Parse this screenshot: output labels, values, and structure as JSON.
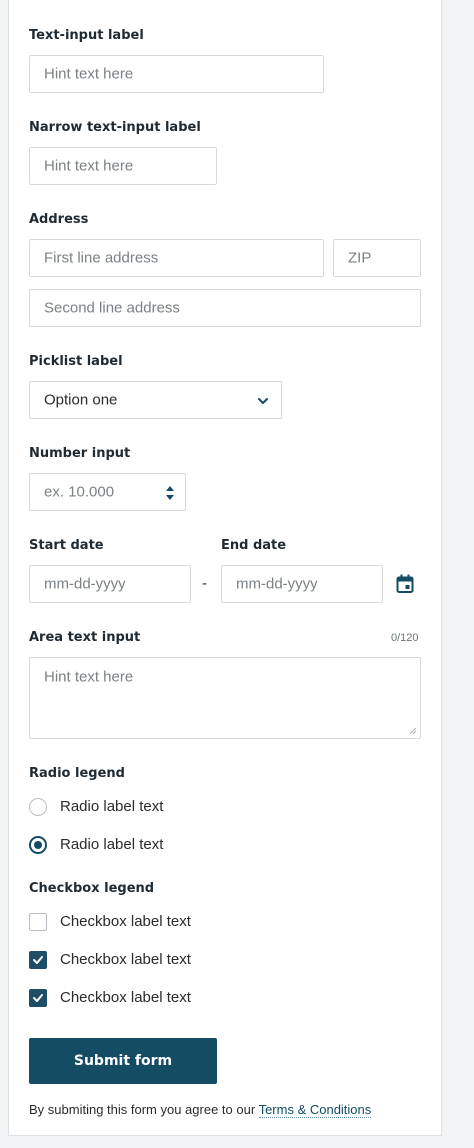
{
  "text_input": {
    "label": "Text-input label",
    "placeholder": "Hint text here"
  },
  "narrow_input": {
    "label": "Narrow text-input label",
    "placeholder": "Hint text here"
  },
  "address": {
    "label": "Address",
    "line1_placeholder": "First line address",
    "zip_placeholder": "ZIP",
    "line2_placeholder": "Second line address"
  },
  "picklist": {
    "label": "Picklist label",
    "selected": "Option one",
    "icon": "chevron-down-icon"
  },
  "number_input": {
    "label": "Number input",
    "placeholder": "ex. 10.000",
    "icon": "spinner-arrows-icon"
  },
  "dates": {
    "start_label": "Start date",
    "end_label": "End date",
    "start_placeholder": "mm-dd-yyyy",
    "end_placeholder": "mm-dd-yyyy",
    "separator": "-",
    "icon": "calendar-icon"
  },
  "textarea": {
    "label": "Area text input",
    "counter": "0/120",
    "placeholder": "Hint text here"
  },
  "radios": {
    "legend": "Radio legend",
    "options": [
      {
        "label": "Radio label text",
        "checked": false
      },
      {
        "label": "Radio label text",
        "checked": true
      }
    ]
  },
  "checkboxes": {
    "legend": "Checkbox legend",
    "options": [
      {
        "label": "Checkbox label text",
        "checked": false
      },
      {
        "label": "Checkbox label text",
        "checked": true
      },
      {
        "label": "Checkbox label text",
        "checked": true
      }
    ]
  },
  "submit": {
    "label": "Submit form"
  },
  "terms": {
    "prefix": "By submiting this form you agree to our",
    "link": "Terms & Conditions"
  },
  "colors": {
    "primary": "#134c63",
    "border": "#d6dadd",
    "placeholder": "#7b8186"
  }
}
